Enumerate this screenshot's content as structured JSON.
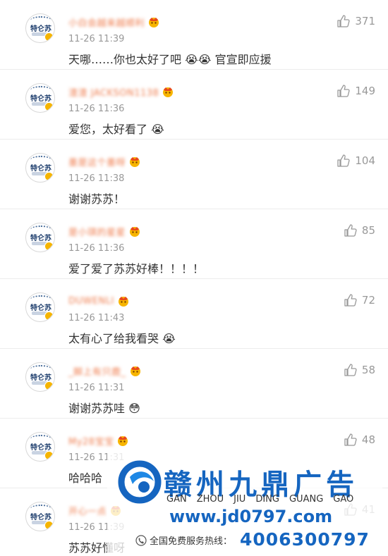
{
  "comments": [
    {
      "name": "小白会越来越顺利",
      "time": "11-26 11:39",
      "text": "天哪……你也太好了吧 😭😭 官宣即应援",
      "likes": "371"
    },
    {
      "name": "渣渣 JACKSON1138",
      "time": "11-26 11:36",
      "text": "爱您，太好看了 😭",
      "likes": "149"
    },
    {
      "name": "墨是这个墨呀",
      "time": "11-26 11:38",
      "text": "谢谢苏苏！",
      "likes": "104"
    },
    {
      "name": "是小琪的星星",
      "time": "11-26 11:36",
      "text": "爱了爱了苏苏好棒！！！！",
      "likes": "85"
    },
    {
      "name": "DUWENLI",
      "time": "11-26 11:43",
      "text": "太有心了给我看哭 😭",
      "likes": "72"
    },
    {
      "name": "_脚上有只鹿_",
      "time": "11-26 11:31",
      "text": "谢谢苏苏哇 😳",
      "likes": "58"
    },
    {
      "name": "My28宝宝",
      "time": "11-26 11:31",
      "text": "哈哈哈",
      "likes": "48"
    },
    {
      "name": "开心一点",
      "time": "11-26 11:39",
      "text": "苏苏好懂呀",
      "likes": "41"
    }
  ],
  "avatar_mark": "特仑苏",
  "watermark": {
    "title": "赣州九鼎广告",
    "pinyin": [
      "GAN",
      "ZHOU",
      "JIU",
      "DING",
      "GUANG",
      "GAO"
    ],
    "url": "www.jd0797.com",
    "hotline_label": "全国免费服务热线：",
    "phone": "4006300797"
  },
  "colors": {
    "username": "#ef7d4e",
    "time": "#999999",
    "text": "#333333",
    "brand_blue": "#1565c0"
  },
  "icons": {
    "like": "thumbs-up-icon",
    "vip": "crown-badge-icon",
    "phone": "phone-icon"
  }
}
